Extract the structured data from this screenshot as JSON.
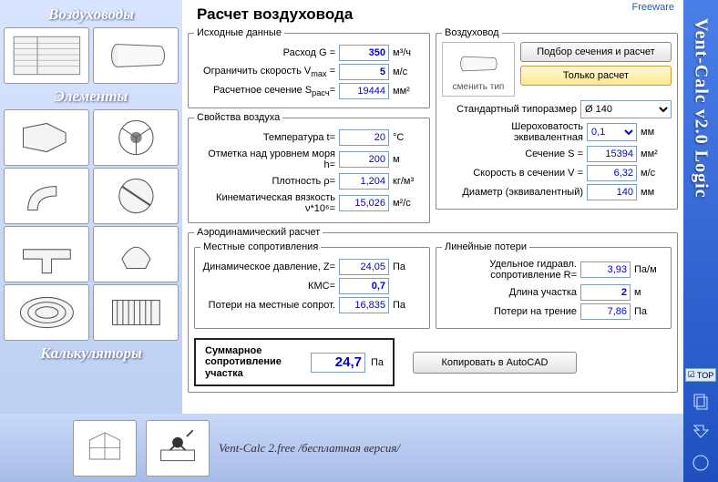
{
  "freeware": "Freeware",
  "app_logo": "Vent-Calc v2.0 Logic",
  "top_btn": "TOP",
  "title": "Расчет воздуховода",
  "left": {
    "h1": "Воздуховоды",
    "h2": "Элементы",
    "h3": "Калькуляторы"
  },
  "bottom_text": "Vent-Calc 2.free /бесплатная версия/",
  "input": {
    "legend": "Исходные данные",
    "flow_lbl": "Расход G =",
    "flow_val": "350",
    "flow_unit": "м³/ч",
    "vmax_lbl": "Ограничить скорость V",
    "vmax_sub": "max",
    "vmax_eq": " =",
    "vmax_val": "5",
    "vmax_unit": "м/с",
    "sect_lbl": "Расчетное сечение S",
    "sect_sub": "расч",
    "sect_eq": "=",
    "sect_val": "19444",
    "sect_unit": "мм²"
  },
  "air": {
    "legend": "Свойства воздуха",
    "temp_lbl": "Температура t=",
    "temp_val": "20",
    "temp_unit": "°C",
    "alt_lbl": "Отметка над уровнем моря h=",
    "alt_val": "200",
    "alt_unit": "м",
    "dens_lbl": "Плотность ρ=",
    "dens_val": "1,204",
    "dens_unit": "кг/м³",
    "visc_lbl": "Кинематическая вязкость ν*10⁶=",
    "visc_val": "15,026",
    "visc_unit": "м²/с"
  },
  "duct": {
    "legend": "Воздуховод",
    "change": "сменить тип",
    "btn_calc_sel": "Подбор сечения и расчет",
    "btn_calc_only": "Только расчет",
    "std_lbl": "Стандартный типоразмер",
    "std_val": "Ø 140",
    "rough_lbl": "Шероховатость эквивалентная",
    "rough_val": "0,1",
    "rough_unit": "мм",
    "s_lbl": "Сечение S =",
    "s_val": "15394",
    "s_unit": "мм²",
    "v_lbl": "Скорость в сечении V =",
    "v_val": "6,32",
    "v_unit": "м/с",
    "d_lbl": "Диаметр (эквивалентный)",
    "d_val": "140",
    "d_unit": "мм"
  },
  "aero": {
    "legend": "Аэродинамический расчет",
    "local_legend": "Местные сопротивления",
    "z_lbl": "Динамическое давление, Z=",
    "z_val": "24,05",
    "z_unit": "Па",
    "kmc_lbl": "КМС=",
    "kmc_val": "0,7",
    "loss_lbl": "Потери на местные сопрот.",
    "loss_val": "16,835",
    "loss_unit": "Па",
    "line_legend": "Линейные потери",
    "r_lbl": "Удельное гидравл. сопротивление R=",
    "r_val": "3,93",
    "r_unit": "Па/м",
    "len_lbl": "Длина участка",
    "len_val": "2",
    "len_unit": "м",
    "fric_lbl": "Потери на трение",
    "fric_val": "7,86",
    "fric_unit": "Па",
    "total_lbl": "Суммарное сопротивление участка",
    "total_val": "24,7",
    "total_unit": "Па",
    "copy_btn": "Копировать в AutoCAD"
  }
}
